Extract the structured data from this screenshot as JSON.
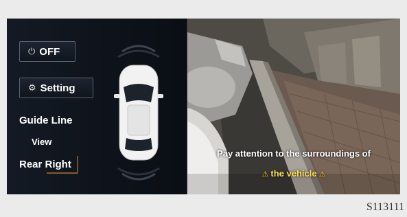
{
  "controls": {
    "off_label": "OFF",
    "off_icon": "power-icon",
    "setting_label": "Setting",
    "setting_icon": "gear-icon"
  },
  "guide_line_label": "Guide Line",
  "view_label": "View",
  "view_value": "Rear Right",
  "warning": {
    "line1": "Pay attention to the surroundings of",
    "line2": "the vehicle"
  },
  "figure_code": "S113111",
  "colors": {
    "screen_bg": "#0c0f16",
    "warning_yellow": "#ffe050",
    "text_white": "#ffffff"
  }
}
